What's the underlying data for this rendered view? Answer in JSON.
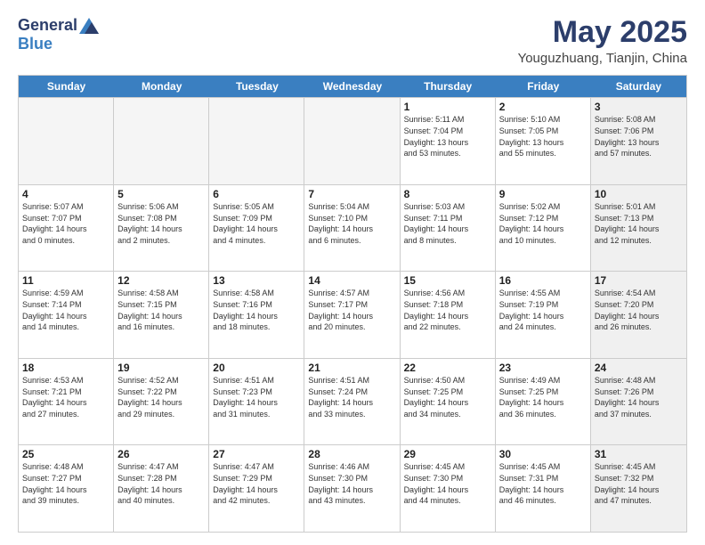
{
  "header": {
    "logo_general": "General",
    "logo_blue": "Blue",
    "month_title": "May 2025",
    "location": "Youguzhuang, Tianjin, China"
  },
  "calendar": {
    "days_of_week": [
      "Sunday",
      "Monday",
      "Tuesday",
      "Wednesday",
      "Thursday",
      "Friday",
      "Saturday"
    ],
    "weeks": [
      [
        {
          "day": "",
          "info": "",
          "empty": true
        },
        {
          "day": "",
          "info": "",
          "empty": true
        },
        {
          "day": "",
          "info": "",
          "empty": true
        },
        {
          "day": "",
          "info": "",
          "empty": true
        },
        {
          "day": "1",
          "info": "Sunrise: 5:11 AM\nSunset: 7:04 PM\nDaylight: 13 hours\nand 53 minutes."
        },
        {
          "day": "2",
          "info": "Sunrise: 5:10 AM\nSunset: 7:05 PM\nDaylight: 13 hours\nand 55 minutes."
        },
        {
          "day": "3",
          "info": "Sunrise: 5:08 AM\nSunset: 7:06 PM\nDaylight: 13 hours\nand 57 minutes.",
          "shaded": true
        }
      ],
      [
        {
          "day": "4",
          "info": "Sunrise: 5:07 AM\nSunset: 7:07 PM\nDaylight: 14 hours\nand 0 minutes."
        },
        {
          "day": "5",
          "info": "Sunrise: 5:06 AM\nSunset: 7:08 PM\nDaylight: 14 hours\nand 2 minutes."
        },
        {
          "day": "6",
          "info": "Sunrise: 5:05 AM\nSunset: 7:09 PM\nDaylight: 14 hours\nand 4 minutes."
        },
        {
          "day": "7",
          "info": "Sunrise: 5:04 AM\nSunset: 7:10 PM\nDaylight: 14 hours\nand 6 minutes."
        },
        {
          "day": "8",
          "info": "Sunrise: 5:03 AM\nSunset: 7:11 PM\nDaylight: 14 hours\nand 8 minutes."
        },
        {
          "day": "9",
          "info": "Sunrise: 5:02 AM\nSunset: 7:12 PM\nDaylight: 14 hours\nand 10 minutes."
        },
        {
          "day": "10",
          "info": "Sunrise: 5:01 AM\nSunset: 7:13 PM\nDaylight: 14 hours\nand 12 minutes.",
          "shaded": true
        }
      ],
      [
        {
          "day": "11",
          "info": "Sunrise: 4:59 AM\nSunset: 7:14 PM\nDaylight: 14 hours\nand 14 minutes."
        },
        {
          "day": "12",
          "info": "Sunrise: 4:58 AM\nSunset: 7:15 PM\nDaylight: 14 hours\nand 16 minutes."
        },
        {
          "day": "13",
          "info": "Sunrise: 4:58 AM\nSunset: 7:16 PM\nDaylight: 14 hours\nand 18 minutes."
        },
        {
          "day": "14",
          "info": "Sunrise: 4:57 AM\nSunset: 7:17 PM\nDaylight: 14 hours\nand 20 minutes."
        },
        {
          "day": "15",
          "info": "Sunrise: 4:56 AM\nSunset: 7:18 PM\nDaylight: 14 hours\nand 22 minutes."
        },
        {
          "day": "16",
          "info": "Sunrise: 4:55 AM\nSunset: 7:19 PM\nDaylight: 14 hours\nand 24 minutes."
        },
        {
          "day": "17",
          "info": "Sunrise: 4:54 AM\nSunset: 7:20 PM\nDaylight: 14 hours\nand 26 minutes.",
          "shaded": true
        }
      ],
      [
        {
          "day": "18",
          "info": "Sunrise: 4:53 AM\nSunset: 7:21 PM\nDaylight: 14 hours\nand 27 minutes."
        },
        {
          "day": "19",
          "info": "Sunrise: 4:52 AM\nSunset: 7:22 PM\nDaylight: 14 hours\nand 29 minutes."
        },
        {
          "day": "20",
          "info": "Sunrise: 4:51 AM\nSunset: 7:23 PM\nDaylight: 14 hours\nand 31 minutes."
        },
        {
          "day": "21",
          "info": "Sunrise: 4:51 AM\nSunset: 7:24 PM\nDaylight: 14 hours\nand 33 minutes."
        },
        {
          "day": "22",
          "info": "Sunrise: 4:50 AM\nSunset: 7:25 PM\nDaylight: 14 hours\nand 34 minutes."
        },
        {
          "day": "23",
          "info": "Sunrise: 4:49 AM\nSunset: 7:25 PM\nDaylight: 14 hours\nand 36 minutes."
        },
        {
          "day": "24",
          "info": "Sunrise: 4:48 AM\nSunset: 7:26 PM\nDaylight: 14 hours\nand 37 minutes.",
          "shaded": true
        }
      ],
      [
        {
          "day": "25",
          "info": "Sunrise: 4:48 AM\nSunset: 7:27 PM\nDaylight: 14 hours\nand 39 minutes."
        },
        {
          "day": "26",
          "info": "Sunrise: 4:47 AM\nSunset: 7:28 PM\nDaylight: 14 hours\nand 40 minutes."
        },
        {
          "day": "27",
          "info": "Sunrise: 4:47 AM\nSunset: 7:29 PM\nDaylight: 14 hours\nand 42 minutes."
        },
        {
          "day": "28",
          "info": "Sunrise: 4:46 AM\nSunset: 7:30 PM\nDaylight: 14 hours\nand 43 minutes."
        },
        {
          "day": "29",
          "info": "Sunrise: 4:45 AM\nSunset: 7:30 PM\nDaylight: 14 hours\nand 44 minutes."
        },
        {
          "day": "30",
          "info": "Sunrise: 4:45 AM\nSunset: 7:31 PM\nDaylight: 14 hours\nand 46 minutes."
        },
        {
          "day": "31",
          "info": "Sunrise: 4:45 AM\nSunset: 7:32 PM\nDaylight: 14 hours\nand 47 minutes.",
          "shaded": true
        }
      ]
    ]
  }
}
